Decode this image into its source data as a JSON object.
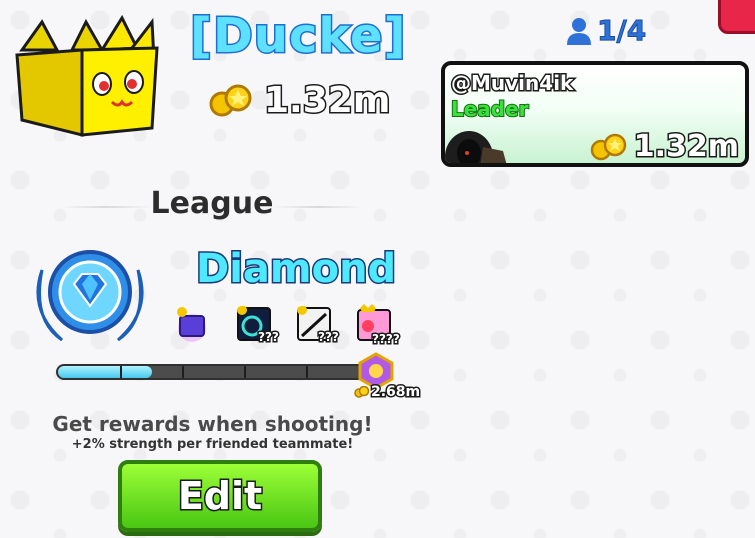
{
  "clan": {
    "name": "[Ducke]",
    "coins": "1.32m",
    "member_count": "1/4"
  },
  "member": {
    "username": "@Muvin4ik",
    "role": "Leader",
    "coins": "1.32m"
  },
  "league": {
    "heading": "League",
    "rank": "Diamond",
    "progress_fraction": 0.3,
    "rewards": [
      {
        "icon": "gift-box-icon",
        "label": ""
      },
      {
        "icon": "portal-icon",
        "label": "???"
      },
      {
        "icon": "tool-icon",
        "label": "???"
      },
      {
        "icon": "pink-item-icon",
        "label": "????"
      }
    ],
    "goal_value": "2.68m"
  },
  "info": {
    "main": "Get rewards when shooting!",
    "sub": "+2% strength per friended teammate!"
  },
  "edit_label": "Edit",
  "colors": {
    "rank": "#4fe9ff",
    "name": "#5ee0ff",
    "leader": "#37e33b",
    "edit_button": "#6be021"
  }
}
